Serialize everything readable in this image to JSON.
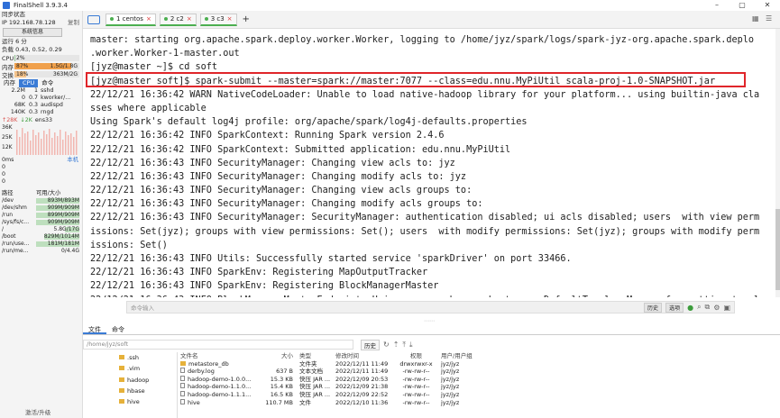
{
  "app": {
    "title": "FinalShell 3.9.3.4"
  },
  "window_buttons": [
    "–",
    "▢",
    "✕"
  ],
  "sidebar": {
    "sync_status": "同步状态",
    "ip": "IP 192.168.78.128",
    "copy": "复制",
    "sysinfo_button": "系统信息",
    "uptime": "运行 6 分",
    "load": "负载 0.43, 0.52, 0.29",
    "cpu": {
      "label": "CPU",
      "value_text": "2%",
      "fraction": 0.02
    },
    "mem": {
      "label": "内存",
      "pct": "87%",
      "value_text": "1.5G/1.8G",
      "fraction": 0.87
    },
    "swap": {
      "label": "交换",
      "pct": "18%",
      "value_text": "363M/2G",
      "fraction": 0.18
    },
    "proc_tabs": [
      "内存",
      "CPU",
      "命令"
    ],
    "processes": [
      {
        "mem": "2.2M",
        "cpu": "1",
        "cmd": "sshd"
      },
      {
        "mem": "0",
        "cpu": "0.7",
        "cmd": "kworker/..."
      },
      {
        "mem": "68K",
        "cpu": "0.3",
        "cmd": "audispd"
      },
      {
        "mem": "140K",
        "cpu": "0.3",
        "cmd": "rngd"
      }
    ],
    "net": {
      "up": "↑28K",
      "down": "↓2K",
      "iface": "ens33"
    },
    "net_axis": [
      "36K",
      "25K",
      "12K"
    ],
    "latency": {
      "value": "0ms",
      "target": "本机",
      "axis": [
        "0",
        "0",
        "0"
      ]
    },
    "disk_header": {
      "path": "路径",
      "size": "可用/大小"
    },
    "disks": [
      {
        "path": "/dev",
        "size": "893M/893M",
        "fraction": 1.0
      },
      {
        "path": "/dev/shm",
        "size": "909M/909M",
        "fraction": 1.0
      },
      {
        "path": "/run",
        "size": "899M/909M",
        "fraction": 0.99
      },
      {
        "path": "/sys/fs/c...",
        "size": "909M/909M",
        "fraction": 1.0
      },
      {
        "path": "/",
        "size": "5.8G/17G",
        "fraction": 0.34
      },
      {
        "path": "/boot",
        "size": "829M/1014M",
        "fraction": 0.82
      },
      {
        "path": "/run/use...",
        "size": "181M/181M",
        "fraction": 1.0
      },
      {
        "path": "/run/me...",
        "size": "0/4.4G",
        "fraction": 0.0
      }
    ],
    "upgrade": "激活/升级"
  },
  "tabs": [
    {
      "label": "1 centos",
      "active": true
    },
    {
      "label": "2 c2",
      "active": false
    },
    {
      "label": "3 c3",
      "active": false
    }
  ],
  "terminal": {
    "lines": [
      "master: starting org.apache.spark.deploy.worker.Worker, logging to /home/jyz/spark/logs/spark-jyz-org.apache.spark.deplo",
      ".worker.Worker-1-master.out",
      "[jyz@master ~]$ cd soft",
      "[jyz@master soft]$ spark-submit --master=spark://master:7077 --class=edu.nnu.MyPiUtil scala-proj-1.0-SNAPSHOT.jar",
      "22/12/21 16:36:42 WARN NativeCodeLoader: Unable to load native-hadoop library for your platform... using builtin-java cla",
      "sses where applicable",
      "Using Spark's default log4j profile: org/apache/spark/log4j-defaults.properties",
      "22/12/21 16:36:42 INFO SparkContext: Running Spark version 2.4.6",
      "22/12/21 16:36:42 INFO SparkContext: Submitted application: edu.nnu.MyPiUtil",
      "22/12/21 16:36:43 INFO SecurityManager: Changing view acls to: jyz",
      "22/12/21 16:36:43 INFO SecurityManager: Changing modify acls to: jyz",
      "22/12/21 16:36:43 INFO SecurityManager: Changing view acls groups to:",
      "22/12/21 16:36:43 INFO SecurityManager: Changing modify acls groups to:",
      "22/12/21 16:36:43 INFO SecurityManager: SecurityManager: authentication disabled; ui acls disabled; users  with view perm",
      "issions: Set(jyz); groups with view permissions: Set(); users  with modify permissions: Set(jyz); groups with modify perm",
      "issions: Set()",
      "22/12/21 16:36:43 INFO Utils: Successfully started service 'sparkDriver' on port 33466.",
      "22/12/21 16:36:43 INFO SparkEnv: Registering MapOutputTracker",
      "22/12/21 16:36:43 INFO SparkEnv: Registering BlockManagerMaster",
      "22/12/21 16:36:43 INFO BlockManagerMasterEndpoint: Using org.apache.spark.storage.DefaultTopologyMapper for getting topol"
    ]
  },
  "command_bar": {
    "placeholder": "命令输入",
    "history": "历史",
    "options": "选项"
  },
  "panel_tabs": [
    "文件",
    "命令"
  ],
  "path": {
    "value": "/home/jyz/soft",
    "history": "历史"
  },
  "tree": [
    ".ssh",
    ".vim",
    "hadoop",
    "hbase",
    "hive"
  ],
  "files": {
    "headers": {
      "name": "文件名",
      "size": "大小",
      "type": "类型",
      "modified": "修改时间",
      "perm": "权限",
      "owner": "用户/用户组"
    },
    "rows": [
      {
        "name": "metastore_db",
        "size": "",
        "type": "文件夹",
        "modified": "2022/12/11 11:49",
        "perm": "drwxrwxr-x",
        "owner": "jyz/jyz",
        "folder": true
      },
      {
        "name": "derby.log",
        "size": "637 B",
        "type": "文本文档",
        "modified": "2022/12/11 11:49",
        "perm": "-rw-rw-r--",
        "owner": "jyz/jyz",
        "folder": false
      },
      {
        "name": "hadoop-demo-1.0.0...",
        "size": "15.3 KB",
        "type": "快压 JAR ...",
        "modified": "2022/12/09 20:53",
        "perm": "-rw-rw-r--",
        "owner": "jyz/jyz",
        "folder": false
      },
      {
        "name": "hadoop-demo-1.1.0...",
        "size": "15.4 KB",
        "type": "快压 JAR ...",
        "modified": "2022/12/09 21:38",
        "perm": "-rw-rw-r--",
        "owner": "jyz/jyz",
        "folder": false
      },
      {
        "name": "hadoop-demo-1.1.1...",
        "size": "16.5 KB",
        "type": "快压 JAR ...",
        "modified": "2022/12/09 22:52",
        "perm": "-rw-rw-r--",
        "owner": "jyz/jyz",
        "folder": false
      },
      {
        "name": "hive",
        "size": "110.7 MB",
        "type": "文件",
        "modified": "2022/12/10 11:36",
        "perm": "-rw-rw-r--",
        "owner": "jyz/jyz",
        "folder": false
      }
    ]
  }
}
